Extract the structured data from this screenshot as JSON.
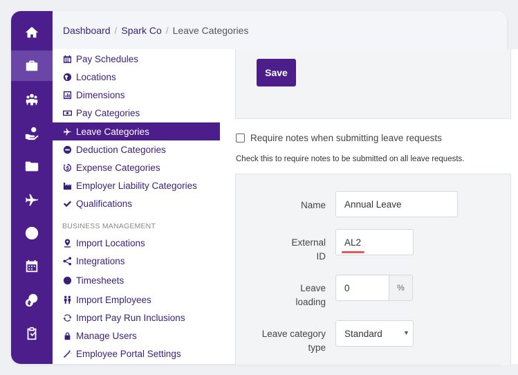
{
  "breadcrumb": {
    "items": [
      "Dashboard",
      "Spark Co",
      "Leave Categories"
    ],
    "sep": "/"
  },
  "rail": {
    "icons": [
      "home-icon",
      "briefcase-icon",
      "people-icon",
      "hand-coin-icon",
      "folder-icon",
      "plane-icon",
      "clock-icon",
      "calendar-icon",
      "coins-icon",
      "clipboard-check-icon"
    ],
    "active_index": 1
  },
  "subnav": {
    "items_top": [
      {
        "label": "Pay Schedules",
        "icon": "calendar-icon"
      },
      {
        "label": "Locations",
        "icon": "globe-icon"
      },
      {
        "label": "Dimensions",
        "icon": "bar-chart-icon"
      },
      {
        "label": "Pay Categories",
        "icon": "money-icon"
      },
      {
        "label": "Leave Categories",
        "icon": "plane-icon",
        "active": true
      },
      {
        "label": "Deduction Categories",
        "icon": "minus-circle-icon"
      },
      {
        "label": "Expense Categories",
        "icon": "dollar-cycle-icon"
      },
      {
        "label": "Employer Liability Categories",
        "icon": "factory-icon"
      },
      {
        "label": "Qualifications",
        "icon": "check-icon"
      }
    ],
    "section_heading": "BUSINESS MANAGEMENT",
    "items_bottom": [
      {
        "label": "Import Locations",
        "icon": "map-pin-icon"
      },
      {
        "label": "Integrations",
        "icon": "share-icon"
      },
      {
        "label": "Timesheets",
        "icon": "clock-icon"
      },
      {
        "label": "Import Employees",
        "icon": "people-icon"
      },
      {
        "label": "Import Pay Run Inclusions",
        "icon": "refresh-icon"
      },
      {
        "label": "Manage Users",
        "icon": "lock-icon"
      },
      {
        "label": "Employee Portal Settings",
        "icon": "wand-icon"
      }
    ]
  },
  "main": {
    "save_label": "Save",
    "require_notes_label": "Require notes when submitting leave requests",
    "require_notes_checked": false,
    "require_notes_hint": "Check this to require notes to be submitted on all leave requests.",
    "form": {
      "name_label": "Name",
      "name_value": "Annual Leave",
      "external_id_label_line1": "External",
      "external_id_label_line2": "ID",
      "external_id_value": "AL2",
      "leave_loading_label_line1": "Leave",
      "leave_loading_label_line2": "loading",
      "leave_loading_value": "0",
      "leave_loading_unit": "%",
      "leave_type_label_line1": "Leave category",
      "leave_type_label_line2": "type",
      "leave_type_value": "Standard"
    }
  },
  "colors": {
    "brand": "#4b1e8c",
    "active_rail": "#6a46a6",
    "link": "#3a1f78",
    "underline": "#e8565b"
  }
}
